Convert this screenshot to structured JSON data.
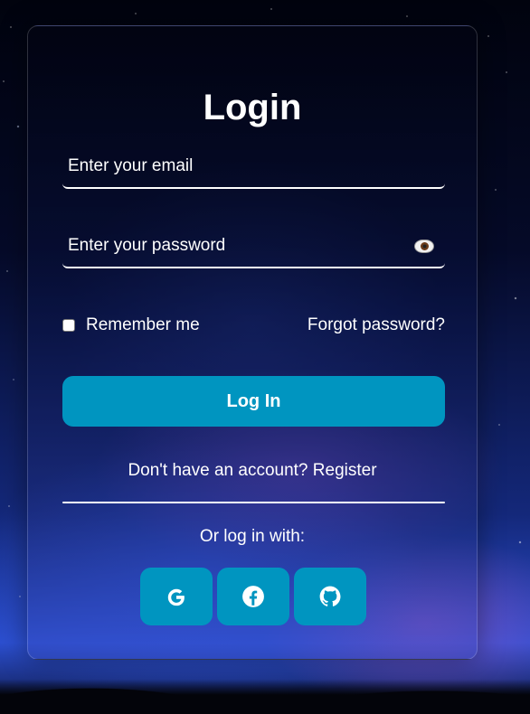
{
  "form": {
    "title": "Login",
    "email_placeholder": "Enter your email",
    "password_placeholder": "Enter your password",
    "remember_label": "Remember me",
    "remember_checked": false,
    "forgot_label": "Forgot password?",
    "login_label": "Log In",
    "register_text": "Don't have an account? Register",
    "or_text": "Or log in with:"
  },
  "social": [
    {
      "name": "google",
      "icon": "google-icon"
    },
    {
      "name": "facebook",
      "icon": "facebook-icon"
    },
    {
      "name": "github",
      "icon": "github-icon"
    }
  ],
  "colors": {
    "accent": "#0095c0",
    "text": "#ffffff"
  }
}
